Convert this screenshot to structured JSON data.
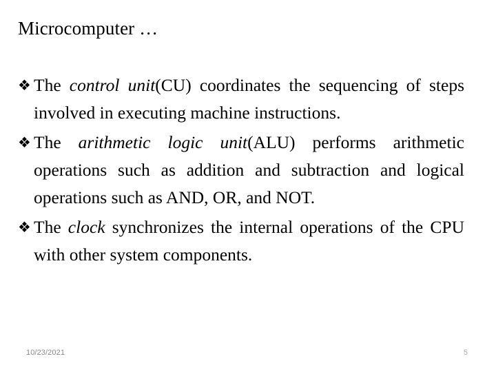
{
  "slide": {
    "title": "Microcomputer …",
    "background_color": "#ffffff",
    "text_color": "#000000",
    "bullet_glyph": "❖",
    "bullets": [
      {
        "marker": "❖",
        "segment_1": "The ",
        "segment_2_italic": "control unit",
        "segment_3": "(CU) coordinates the sequencing of steps involved in executing machine instructions."
      },
      {
        "marker": "❖",
        "segment_1": "The ",
        "segment_2_italic": "arithmetic logic unit",
        "segment_3": "(ALU) performs arithmetic operations such as addition and subtraction and logical operations such as AND, OR, and NOT."
      },
      {
        "marker": "❖",
        "segment_1": "The ",
        "segment_2_italic": "clock",
        "segment_3": " synchronizes the internal operations of the CPU with other system components."
      }
    ],
    "footer": {
      "date": "10/23/2021",
      "page_number": "5",
      "date_color": "#898989",
      "page_number_color": "#a8a8a8"
    }
  }
}
